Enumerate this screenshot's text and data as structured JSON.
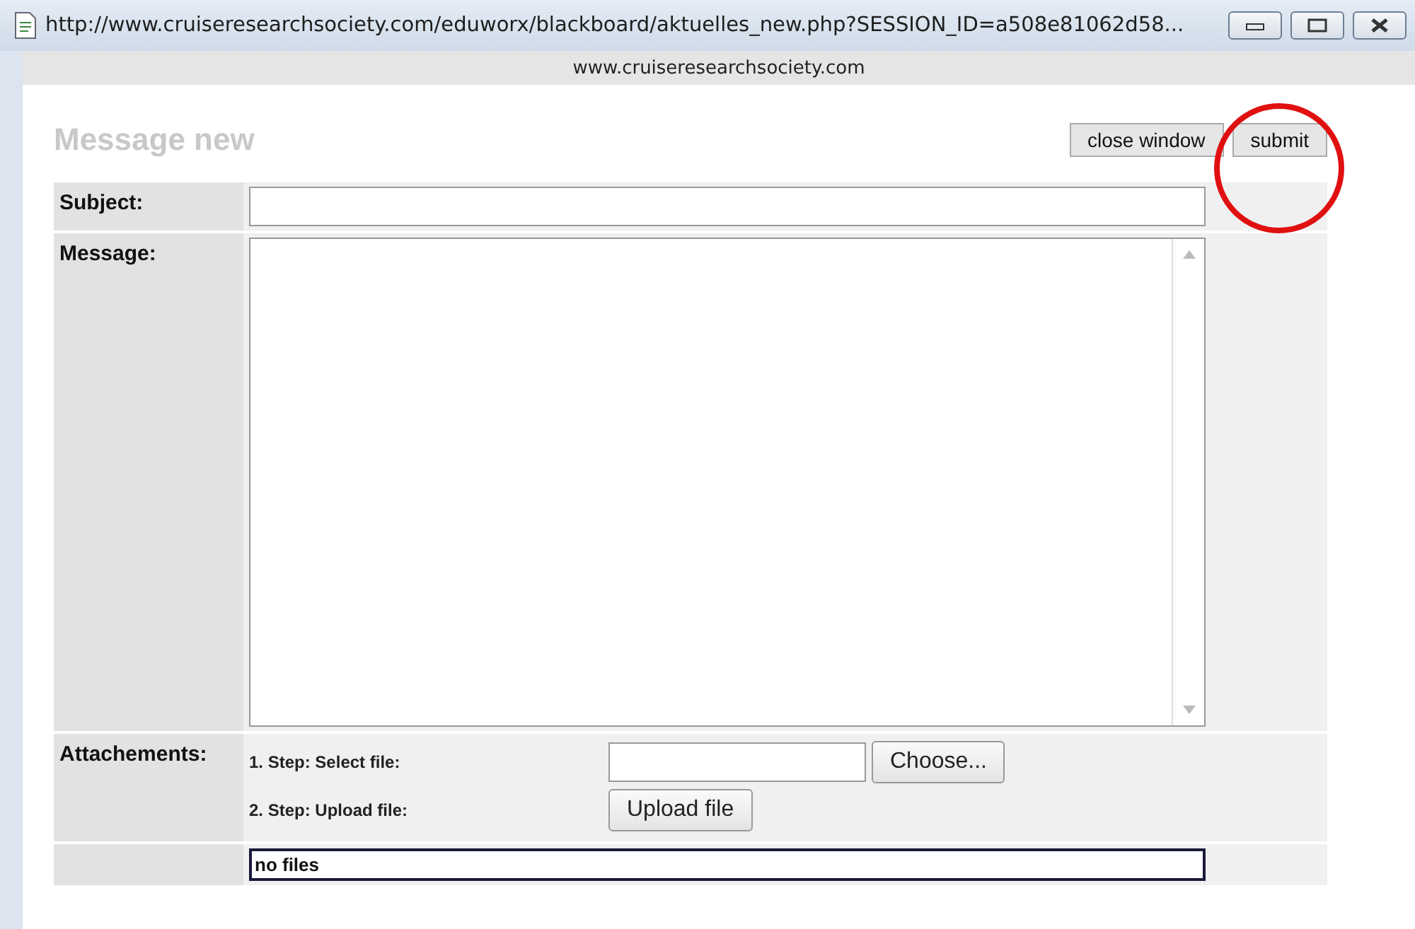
{
  "window": {
    "title": "http://www.cruiseresearchsociety.com/eduworx/blackboard/aktuelles_new.php?SESSION_ID=a508e81062d58...",
    "address": "www.cruiseresearchsociety.com"
  },
  "page": {
    "title": "Message new"
  },
  "buttons": [
    {
      "label": "close window",
      "highlighted": false
    },
    {
      "label": "submit",
      "highlighted": true
    }
  ],
  "form": {
    "subject": {
      "label": "Subject:"
    },
    "message": {
      "label": "Message:"
    },
    "attachments": {
      "label": "Attachements:",
      "step1": "1. Step: Select file:",
      "choose": "Choose...",
      "step2": "2. Step: Upload file:",
      "upload": "Upload file",
      "files": "no files"
    }
  }
}
